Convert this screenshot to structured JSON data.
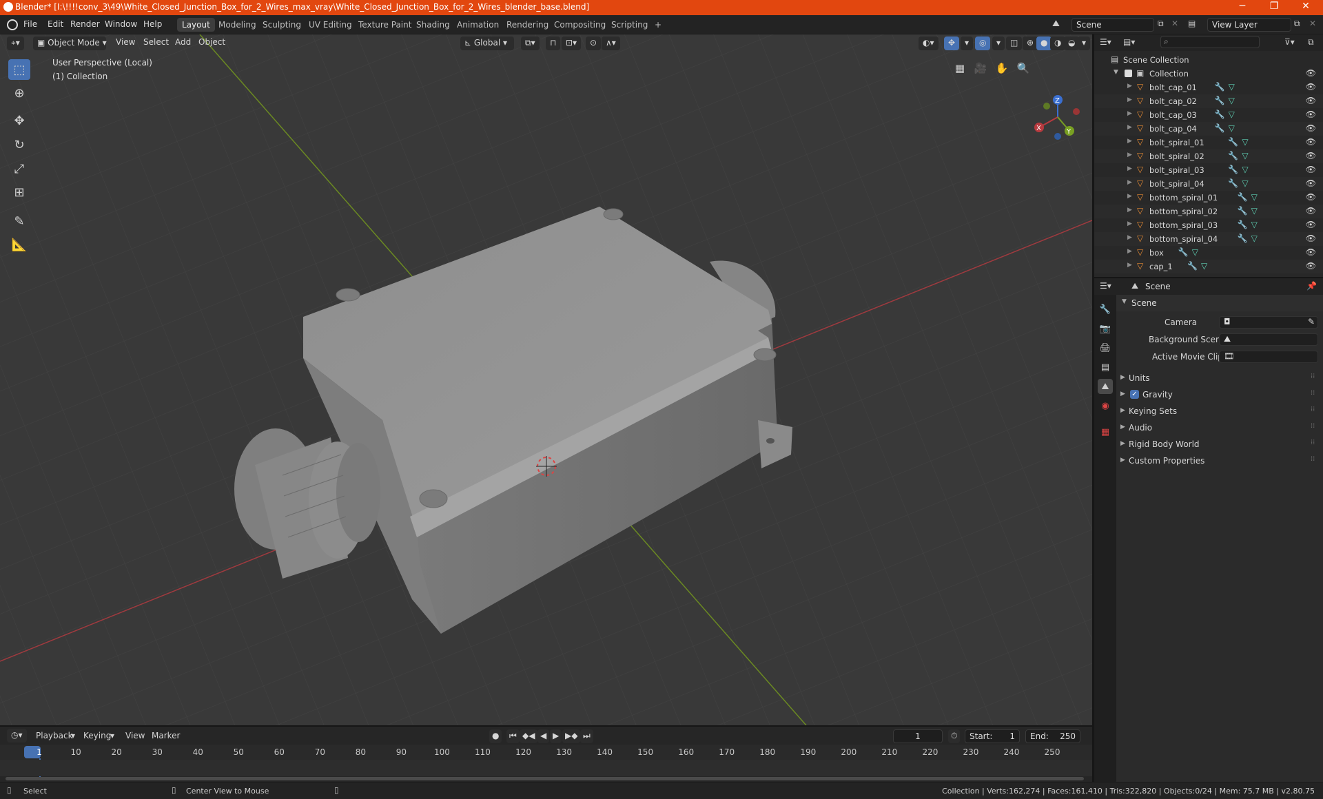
{
  "titlebar": {
    "title": "Blender* [I:\\!!!!conv_3\\49\\White_Closed_Junction_Box_for_2_Wires_max_vray\\White_Closed_Junction_Box_for_2_Wires_blender_base.blend]",
    "minimize": "─",
    "maximize": "❐",
    "close": "✕"
  },
  "menu": {
    "file": "File",
    "edit": "Edit",
    "render": "Render",
    "window": "Window",
    "help": "Help"
  },
  "workspaces": [
    "Layout",
    "Modeling",
    "Sculpting",
    "UV Editing",
    "Texture Paint",
    "Shading",
    "Animation",
    "Rendering",
    "Compositing",
    "Scripting"
  ],
  "add_workspace": "+",
  "scene_field": "Scene",
  "view_layer_field": "View Layer",
  "viewport": {
    "mode": "Object Mode",
    "view": "View",
    "select": "Select",
    "add": "Add",
    "object": "Object",
    "orientation": "Global",
    "perspective": "User Perspective (Local)",
    "collection_info": "(1) Collection"
  },
  "gizmo": {
    "x": "X",
    "y": "Y",
    "z": "Z"
  },
  "outliner": {
    "search_placeholder": "",
    "root": "Scene Collection",
    "collection": "Collection",
    "items": [
      "bolt_cap_01",
      "bolt_cap_02",
      "bolt_cap_03",
      "bolt_cap_04",
      "bolt_spiral_01",
      "bolt_spiral_02",
      "bolt_spiral_03",
      "bolt_spiral_04",
      "bottom_spiral_01",
      "bottom_spiral_02",
      "bottom_spiral_03",
      "bottom_spiral_04",
      "box",
      "cap_1"
    ]
  },
  "properties": {
    "header": "Scene",
    "panel": "Scene",
    "camera_label": "Camera",
    "background_scene_label": "Background Scene",
    "active_movie_clip_label": "Active Movie Clip",
    "sections": [
      "Units",
      "Gravity",
      "Keying Sets",
      "Audio",
      "Rigid Body World",
      "Custom Properties"
    ],
    "gravity_checked": true
  },
  "timeline": {
    "playback": "Playback",
    "keying": "Keying",
    "view": "View",
    "marker": "Marker",
    "current_frame": "1",
    "start_label": "Start:",
    "start": "1",
    "end_label": "End:",
    "end": "250",
    "ticks": [
      "1",
      "10",
      "20",
      "30",
      "40",
      "50",
      "60",
      "70",
      "80",
      "90",
      "100",
      "110",
      "120",
      "130",
      "140",
      "150",
      "160",
      "170",
      "180",
      "190",
      "200",
      "210",
      "220",
      "230",
      "240",
      "250"
    ]
  },
  "statusbar": {
    "select": "Select",
    "center_view": "Center View to Mouse",
    "stats": "Collection | Verts:162,274 | Faces:161,410 | Tris:322,820 | Objects:0/24 | Mem: 75.7 MB | v2.80.75"
  },
  "colors": {
    "titlebar": "#e2470f",
    "accent": "#4772b3",
    "x_axis": "#b83a3f",
    "y_axis": "#79a022",
    "z_axis": "#3a6fd1",
    "mesh_icon": "#e68a33",
    "modifier_icon": "#6aa0e6",
    "data_icon": "#5ed0b4"
  }
}
